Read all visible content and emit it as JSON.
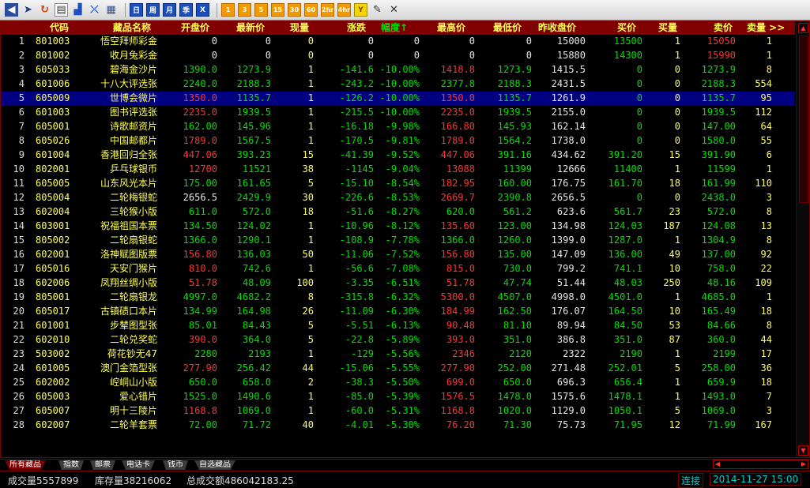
{
  "toolbar": {
    "icons": [
      "back-arrow-icon",
      "cursor-icon",
      "refresh-icon",
      "document-icon",
      "chart-icon",
      "crossed-chart-icon",
      "table-icon"
    ],
    "period_buttons": [
      "日",
      "周",
      "月",
      "季",
      "X"
    ],
    "minute_buttons": [
      "1",
      "3",
      "5",
      "15",
      "30",
      "60",
      "2hr",
      "4hr",
      "Y"
    ],
    "tool_icons": [
      "pencil-icon",
      "close-icon"
    ]
  },
  "table": {
    "headers": {
      "code": "代码",
      "name": "藏品名称",
      "open": "开盘价",
      "last": "最新价",
      "vol": "现量",
      "chg": "涨跌",
      "pct": "幅度↑",
      "high": "最高价",
      "low": "最低价",
      "prev": "昨收盘价",
      "bid": "买价",
      "bidq": "买量",
      "ask": "卖价",
      "askq": "卖量 >>"
    },
    "rows": [
      {
        "i": "1",
        "code": "801003",
        "name": "悟空拜师彩金",
        "open": "0",
        "last": "0",
        "vol": "0",
        "chg": "0",
        "pct": "0",
        "high": "0",
        "low": "0",
        "prev": "15000",
        "bid": "13500",
        "bidq": "1",
        "ask": "15050",
        "askq": "1"
      },
      {
        "i": "2",
        "code": "801002",
        "name": "收月兔彩金",
        "open": "0",
        "last": "0",
        "vol": "0",
        "chg": "0",
        "pct": "0",
        "high": "0",
        "low": "0",
        "prev": "15880",
        "bid": "14300",
        "bidq": "1",
        "ask": "15990",
        "askq": "1"
      },
      {
        "i": "3",
        "code": "605033",
        "name": "碧海金沙片",
        "open": "1390.0",
        "last": "1273.9",
        "vol": "1",
        "chg": "-141.6",
        "pct": "-10.00%",
        "high": "1418.8",
        "low": "1273.9",
        "prev": "1415.5",
        "bid": "0",
        "bidq": "0",
        "ask": "1273.9",
        "askq": "8"
      },
      {
        "i": "4",
        "code": "601006",
        "name": "十八大评选张",
        "open": "2240.0",
        "last": "2188.3",
        "vol": "1",
        "chg": "-243.2",
        "pct": "-10.00%",
        "high": "2377.8",
        "low": "2188.3",
        "prev": "2431.5",
        "bid": "0",
        "bidq": "0",
        "ask": "2188.3",
        "askq": "554"
      },
      {
        "i": "5",
        "code": "605009",
        "name": "世博会微片",
        "open": "1350.0",
        "last": "1135.7",
        "vol": "1",
        "chg": "-126.2",
        "pct": "-10.00%",
        "high": "1350.0",
        "low": "1135.7",
        "prev": "1261.9",
        "bid": "0",
        "bidq": "0",
        "ask": "1135.7",
        "askq": "95"
      },
      {
        "i": "6",
        "code": "601003",
        "name": "图书评选张",
        "open": "2235.0",
        "last": "1939.5",
        "vol": "1",
        "chg": "-215.5",
        "pct": "-10.00%",
        "high": "2235.0",
        "low": "1939.5",
        "prev": "2155.0",
        "bid": "0",
        "bidq": "0",
        "ask": "1939.5",
        "askq": "112"
      },
      {
        "i": "7",
        "code": "605001",
        "name": "诗歌邮资片",
        "open": "162.00",
        "last": "145.96",
        "vol": "1",
        "chg": "-16.18",
        "pct": "-9.98%",
        "high": "166.80",
        "low": "145.93",
        "prev": "162.14",
        "bid": "0",
        "bidq": "0",
        "ask": "147.00",
        "askq": "64"
      },
      {
        "i": "8",
        "code": "605026",
        "name": "中国邮都片",
        "open": "1789.0",
        "last": "1567.5",
        "vol": "1",
        "chg": "-170.5",
        "pct": "-9.81%",
        "high": "1789.0",
        "low": "1564.2",
        "prev": "1738.0",
        "bid": "0",
        "bidq": "0",
        "ask": "1580.0",
        "askq": "55"
      },
      {
        "i": "9",
        "code": "601004",
        "name": "香港回归全张",
        "open": "447.06",
        "last": "393.23",
        "vol": "15",
        "chg": "-41.39",
        "pct": "-9.52%",
        "high": "447.06",
        "low": "391.16",
        "prev": "434.62",
        "bid": "391.20",
        "bidq": "15",
        "ask": "391.90",
        "askq": "6"
      },
      {
        "i": "10",
        "code": "802001",
        "name": "乒乓球银币",
        "open": "12700",
        "last": "11521",
        "vol": "38",
        "chg": "-1145",
        "pct": "-9.04%",
        "high": "13088",
        "low": "11399",
        "prev": "12666",
        "bid": "11400",
        "bidq": "1",
        "ask": "11599",
        "askq": "1"
      },
      {
        "i": "11",
        "code": "605005",
        "name": "山东风光本片",
        "open": "175.00",
        "last": "161.65",
        "vol": "5",
        "chg": "-15.10",
        "pct": "-8.54%",
        "high": "182.95",
        "low": "160.00",
        "prev": "176.75",
        "bid": "161.70",
        "bidq": "18",
        "ask": "161.99",
        "askq": "110"
      },
      {
        "i": "12",
        "code": "805004",
        "name": "二轮梅银蛇",
        "open": "2656.5",
        "last": "2429.9",
        "vol": "30",
        "chg": "-226.6",
        "pct": "-8.53%",
        "high": "2669.7",
        "low": "2390.8",
        "prev": "2656.5",
        "bid": "0",
        "bidq": "0",
        "ask": "2438.0",
        "askq": "3"
      },
      {
        "i": "13",
        "code": "602004",
        "name": "三轮猴小版",
        "open": "611.0",
        "last": "572.0",
        "vol": "18",
        "chg": "-51.6",
        "pct": "-8.27%",
        "high": "620.0",
        "low": "561.2",
        "prev": "623.6",
        "bid": "561.7",
        "bidq": "23",
        "ask": "572.0",
        "askq": "8"
      },
      {
        "i": "14",
        "code": "603001",
        "name": "祝福祖国本票",
        "open": "134.50",
        "last": "124.02",
        "vol": "1",
        "chg": "-10.96",
        "pct": "-8.12%",
        "high": "135.60",
        "low": "123.00",
        "prev": "134.98",
        "bid": "124.03",
        "bidq": "187",
        "ask": "124.08",
        "askq": "13"
      },
      {
        "i": "15",
        "code": "805002",
        "name": "二轮扇银蛇",
        "open": "1366.0",
        "last": "1290.1",
        "vol": "1",
        "chg": "-108.9",
        "pct": "-7.78%",
        "high": "1366.0",
        "low": "1260.0",
        "prev": "1399.0",
        "bid": "1287.0",
        "bidq": "1",
        "ask": "1304.9",
        "askq": "8"
      },
      {
        "i": "16",
        "code": "602001",
        "name": "洛神赋图版票",
        "open": "156.80",
        "last": "136.03",
        "vol": "50",
        "chg": "-11.06",
        "pct": "-7.52%",
        "high": "156.80",
        "low": "135.00",
        "prev": "147.09",
        "bid": "136.00",
        "bidq": "49",
        "ask": "137.00",
        "askq": "92"
      },
      {
        "i": "17",
        "code": "605016",
        "name": "天安门猴片",
        "open": "810.0",
        "last": "742.6",
        "vol": "1",
        "chg": "-56.6",
        "pct": "-7.08%",
        "high": "815.0",
        "low": "730.0",
        "prev": "799.2",
        "bid": "741.1",
        "bidq": "10",
        "ask": "758.0",
        "askq": "22"
      },
      {
        "i": "18",
        "code": "602006",
        "name": "凤翔丝绸小版",
        "open": "51.78",
        "last": "48.09",
        "vol": "100",
        "chg": "-3.35",
        "pct": "-6.51%",
        "high": "51.78",
        "low": "47.74",
        "prev": "51.44",
        "bid": "48.03",
        "bidq": "250",
        "ask": "48.16",
        "askq": "109"
      },
      {
        "i": "19",
        "code": "805001",
        "name": "二轮扇银龙",
        "open": "4997.0",
        "last": "4682.2",
        "vol": "8",
        "chg": "-315.8",
        "pct": "-6.32%",
        "high": "5300.0",
        "low": "4507.0",
        "prev": "4998.0",
        "bid": "4501.0",
        "bidq": "1",
        "ask": "4685.0",
        "askq": "1"
      },
      {
        "i": "20",
        "code": "605017",
        "name": "古镇碛口本片",
        "open": "134.99",
        "last": "164.98",
        "vol": "26",
        "chg": "-11.09",
        "pct": "-6.30%",
        "high": "184.99",
        "low": "162.50",
        "prev": "176.07",
        "bid": "164.50",
        "bidq": "10",
        "ask": "165.49",
        "askq": "18"
      },
      {
        "i": "21",
        "code": "601001",
        "name": "步辇图型张",
        "open": "85.01",
        "last": "84.43",
        "vol": "5",
        "chg": "-5.51",
        "pct": "-6.13%",
        "high": "90.48",
        "low": "81.10",
        "prev": "89.94",
        "bid": "84.50",
        "bidq": "53",
        "ask": "84.66",
        "askq": "8"
      },
      {
        "i": "22",
        "code": "602010",
        "name": "二轮兑奖蛇",
        "open": "390.0",
        "last": "364.0",
        "vol": "5",
        "chg": "-22.8",
        "pct": "-5.89%",
        "high": "393.0",
        "low": "351.0",
        "prev": "386.8",
        "bid": "351.0",
        "bidq": "87",
        "ask": "360.0",
        "askq": "44"
      },
      {
        "i": "23",
        "code": "503002",
        "name": "荷花钞无47",
        "open": "2280",
        "last": "2193",
        "vol": "1",
        "chg": "-129",
        "pct": "-5.56%",
        "high": "2346",
        "low": "2120",
        "prev": "2322",
        "bid": "2190",
        "bidq": "1",
        "ask": "2199",
        "askq": "17"
      },
      {
        "i": "24",
        "code": "601005",
        "name": "澳门金箔型张",
        "open": "277.90",
        "last": "256.42",
        "vol": "44",
        "chg": "-15.06",
        "pct": "-5.55%",
        "high": "277.90",
        "low": "252.00",
        "prev": "271.48",
        "bid": "252.01",
        "bidq": "5",
        "ask": "258.00",
        "askq": "36"
      },
      {
        "i": "25",
        "code": "602002",
        "name": "崆峒山小版",
        "open": "650.0",
        "last": "658.0",
        "vol": "2",
        "chg": "-38.3",
        "pct": "-5.50%",
        "high": "699.0",
        "low": "650.0",
        "prev": "696.3",
        "bid": "656.4",
        "bidq": "1",
        "ask": "659.9",
        "askq": "18"
      },
      {
        "i": "26",
        "code": "605003",
        "name": "爱心错片",
        "open": "1525.0",
        "last": "1490.6",
        "vol": "1",
        "chg": "-85.0",
        "pct": "-5.39%",
        "high": "1576.5",
        "low": "1478.0",
        "prev": "1575.6",
        "bid": "1478.1",
        "bidq": "1",
        "ask": "1493.0",
        "askq": "7"
      },
      {
        "i": "27",
        "code": "605007",
        "name": "明十三陵片",
        "open": "1168.8",
        "last": "1069.0",
        "vol": "1",
        "chg": "-60.0",
        "pct": "-5.31%",
        "high": "1168.8",
        "low": "1020.0",
        "prev": "1129.0",
        "bid": "1050.1",
        "bidq": "5",
        "ask": "1069.0",
        "askq": "3"
      },
      {
        "i": "28",
        "code": "602007",
        "name": "二轮羊套票",
        "open": "72.00",
        "last": "71.72",
        "vol": "40",
        "chg": "-4.01",
        "pct": "-5.30%",
        "high": "76.20",
        "low": "71.30",
        "prev": "75.73",
        "bid": "71.95",
        "bidq": "12",
        "ask": "71.99",
        "askq": "167"
      }
    ],
    "selected_row": 4
  },
  "tabs": [
    "所有藏品",
    "指数",
    "邮票",
    "电话卡",
    "钱币",
    "自选藏品"
  ],
  "status": {
    "volume": "成交量5557899",
    "stock": "库存量38216062",
    "turnover": "总成交额486042183.25",
    "connection": "连接",
    "datetime": "2014-11-27 15:00"
  }
}
